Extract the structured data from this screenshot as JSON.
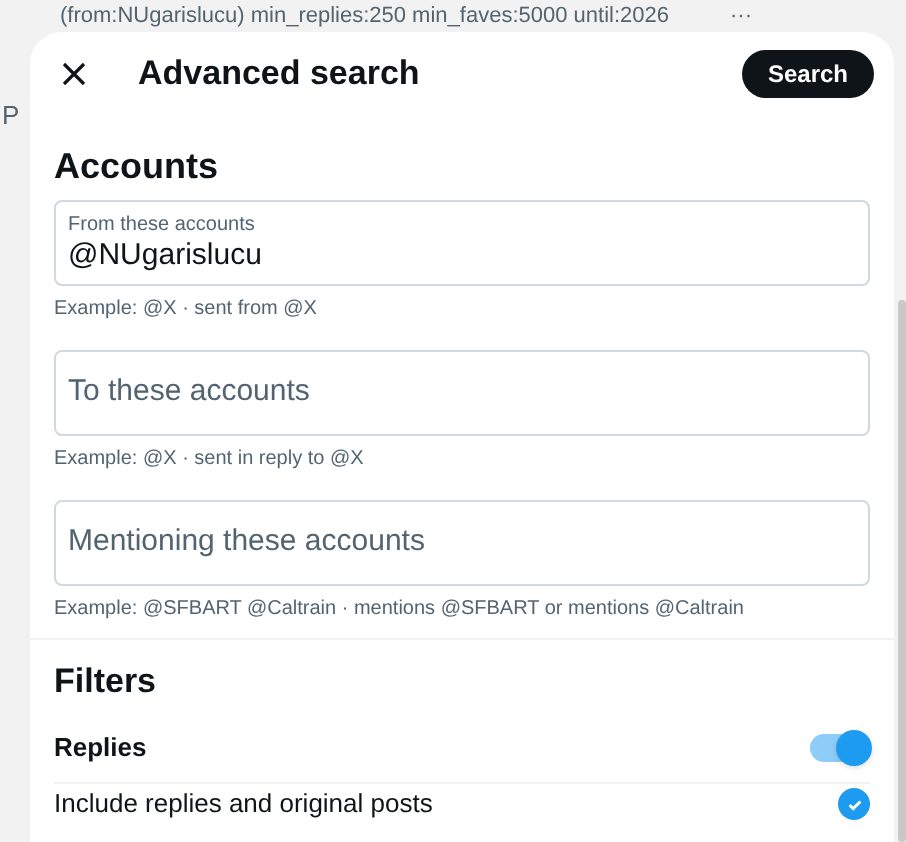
{
  "backdrop": {
    "search_query": "(from:NUgarislucu) min_replies:250 min_faves:5000 until:2026",
    "more": "···",
    "fragment": "P"
  },
  "dialog": {
    "title": "Advanced search",
    "search_button": "Search",
    "accounts": {
      "heading": "Accounts",
      "fields": [
        {
          "label": "From these accounts",
          "value": "@NUgarislucu",
          "hint": "Example: @X · sent from @X"
        },
        {
          "placeholder": "To these accounts",
          "hint": "Example: @X · sent in reply to @X"
        },
        {
          "placeholder": "Mentioning these accounts",
          "hint": "Example: @SFBART @Caltrain · mentions @SFBART or mentions @Caltrain"
        }
      ]
    },
    "filters": {
      "heading": "Filters",
      "options": [
        {
          "kind": "toggle",
          "label": "Replies",
          "on": true
        },
        {
          "kind": "checkbox",
          "label": "Include replies and original posts",
          "checked": true
        }
      ]
    }
  }
}
